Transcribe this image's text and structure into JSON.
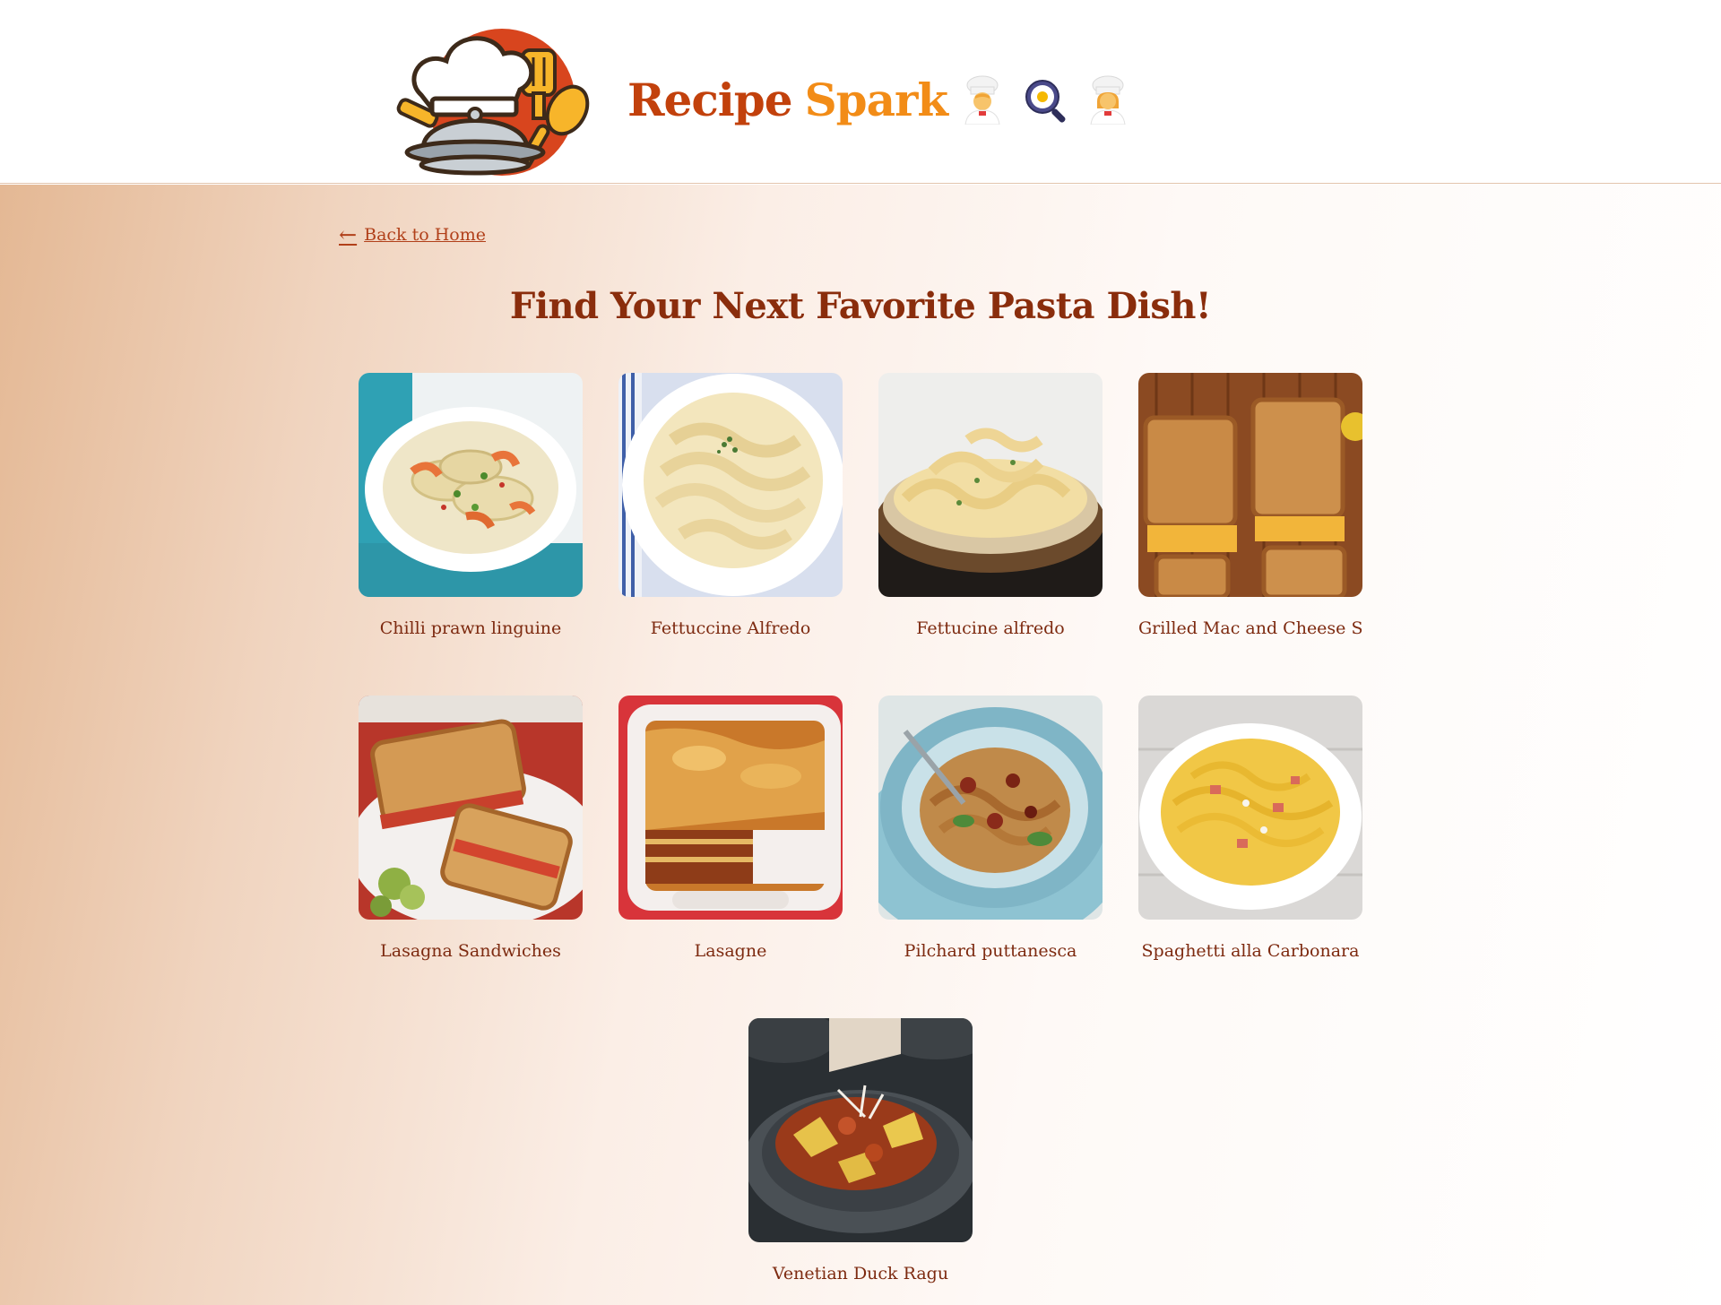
{
  "header": {
    "brand_word1": "Recipe",
    "brand_word2": "Spark",
    "icons": [
      "chef-icon",
      "frying-pan-icon",
      "chef-woman-icon"
    ]
  },
  "nav": {
    "back_label": "Back to Home",
    "back_arrow": "←"
  },
  "main": {
    "title": "Find Your Next Favorite Pasta Dish!"
  },
  "recipes": [
    {
      "name": "Chilli prawn linguine"
    },
    {
      "name": "Fettuccine Alfredo"
    },
    {
      "name": "Fettucine alfredo"
    },
    {
      "name": "Grilled Mac and Cheese Sa"
    },
    {
      "name": "Lasagna Sandwiches"
    },
    {
      "name": "Lasagne"
    },
    {
      "name": "Pilchard puttanesca"
    },
    {
      "name": "Spaghetti alla Carbonara"
    },
    {
      "name": "Venetian Duck Ragu"
    }
  ],
  "colors": {
    "brand_primary": "#c2410c",
    "brand_accent": "#f28c17",
    "title": "#8a2d0c",
    "link": "#b1401a"
  }
}
